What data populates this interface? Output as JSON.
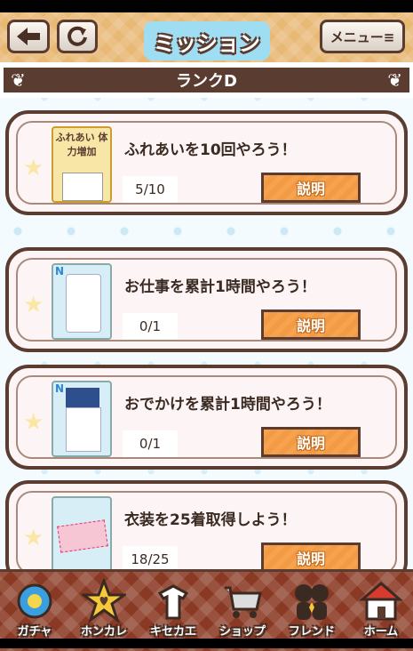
{
  "header": {
    "title": "ミッション",
    "back_icon": "arrow-left-icon",
    "reload_icon": "reload-icon",
    "menu_label": "メニュー≡"
  },
  "rank": {
    "label": "ランクD"
  },
  "missions": [
    {
      "title": "ふれあいを10回やろう！",
      "progress": "5/10",
      "button": "説明",
      "badge_text": "ふれあい 体力増加"
    },
    {
      "title": "お仕事を累計1時間やろう！",
      "progress": "0/1",
      "button": "説明",
      "rarity": "N"
    },
    {
      "title": "おでかけを累計1時間やろう！",
      "progress": "0/1",
      "button": "説明",
      "rarity": "N"
    },
    {
      "title": "衣装を25着取得しよう！",
      "progress": "18/25",
      "button": "説明"
    }
  ],
  "nav": [
    {
      "label": "ガチャ",
      "icon": "gacha-capsule-icon"
    },
    {
      "label": "ホンカレ",
      "icon": "star-heart-icon"
    },
    {
      "label": "キセカエ",
      "icon": "clothes-hanger-icon"
    },
    {
      "label": "ショップ",
      "icon": "shopping-cart-icon"
    },
    {
      "label": "フレンド",
      "icon": "friends-silhouette-icon"
    },
    {
      "label": "ホーム",
      "icon": "house-icon"
    }
  ],
  "colors": {
    "brown": "#5b3c30",
    "orange": "#f39a44",
    "sky": "#8fd3ef"
  }
}
